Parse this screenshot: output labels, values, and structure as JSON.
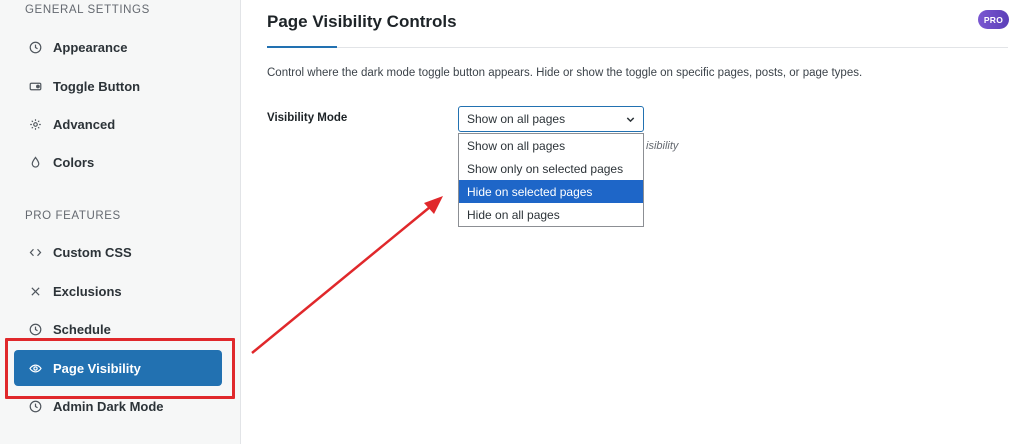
{
  "sidebar": {
    "general_title": "GENERAL SETTINGS",
    "pro_title": "PRO FEATURES",
    "general_items": [
      {
        "label": "Appearance",
        "icon": "clock-icon"
      },
      {
        "label": "Toggle Button",
        "icon": "toggle-icon"
      },
      {
        "label": "Advanced",
        "icon": "gear-icon"
      },
      {
        "label": "Colors",
        "icon": "droplet-icon"
      }
    ],
    "pro_items": [
      {
        "label": "Custom CSS",
        "icon": "code-icon"
      },
      {
        "label": "Exclusions",
        "icon": "x-icon"
      },
      {
        "label": "Schedule",
        "icon": "clock-icon"
      },
      {
        "label": "Page Visibility",
        "icon": "eye-icon",
        "active": true
      },
      {
        "label": "Admin Dark Mode",
        "icon": "clock-icon"
      }
    ]
  },
  "main": {
    "title": "Page Visibility Controls",
    "badge": "PRO",
    "description": "Control where the dark mode toggle button appears. Hide or show the toggle on specific pages, posts, or page types.",
    "visibility": {
      "label": "Visibility Mode",
      "selected": "Show on all pages",
      "hint_partial": "isibility",
      "options": [
        {
          "label": "Show on all pages"
        },
        {
          "label": "Show only on selected pages"
        },
        {
          "label": "Hide on selected pages",
          "highlighted": true
        },
        {
          "label": "Hide on all pages"
        }
      ]
    }
  },
  "colors": {
    "accent": "#2271b1",
    "active_item": "#2271b1",
    "highlight_option": "#1e66c8",
    "annotation_red": "#e0282b",
    "pro_badge": "#6a4bc4"
  }
}
